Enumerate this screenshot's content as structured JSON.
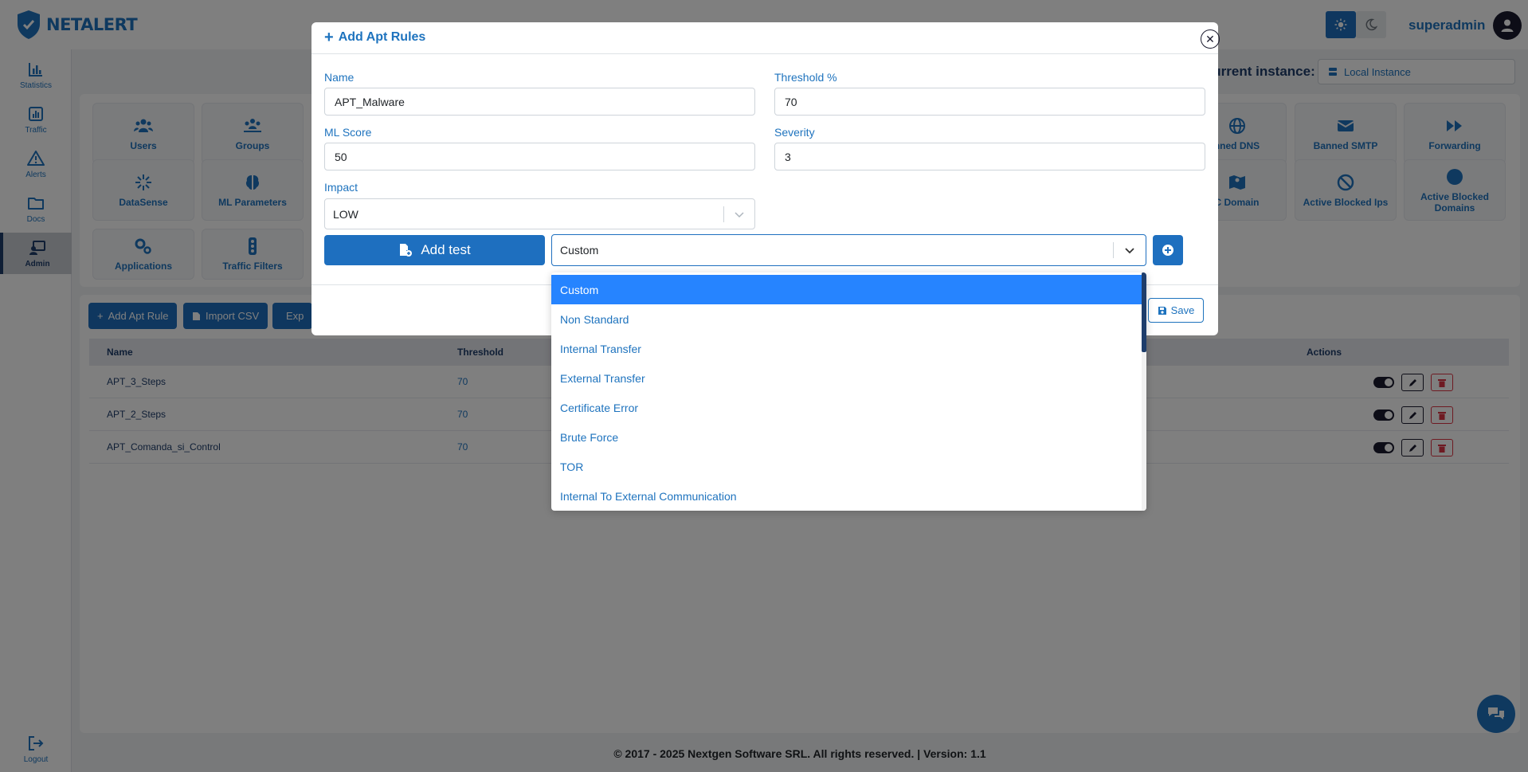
{
  "app": {
    "logo_text": "NETALERT",
    "user_name": "superadmin",
    "instance_label": "Current instance:",
    "instance_value": "Local Instance",
    "footer": "© 2017 - 2025 Nextgen Software SRL. All rights reserved. | Version: 1.1"
  },
  "sidebar": {
    "items": [
      {
        "label": "Statistics",
        "icon": "chart-icon"
      },
      {
        "label": "Traffic",
        "icon": "traffic-chart-icon"
      },
      {
        "label": "Alerts",
        "icon": "warning-icon"
      },
      {
        "label": "Docs",
        "icon": "folder-icon"
      },
      {
        "label": "Admin",
        "icon": "admin-icon",
        "active": true
      }
    ],
    "logout": "Logout"
  },
  "tiles": {
    "row1": [
      "Users",
      "Groups",
      "nned DNS",
      "Banned SMTP",
      "Forwarding"
    ],
    "row2": [
      "DataSense",
      "ML Parameters",
      "C Domain",
      "Active Blocked Ips",
      "Active Blocked Domains"
    ],
    "row3": [
      "Applications",
      "Traffic Filters"
    ]
  },
  "toolbar": {
    "add_rule": "Add Apt Rule",
    "import_csv": "Import CSV",
    "export": "Exp"
  },
  "table": {
    "headers": {
      "name": "Name",
      "threshold": "Threshold",
      "actions": "Actions"
    },
    "rows": [
      {
        "name": "APT_3_Steps",
        "threshold": "70"
      },
      {
        "name": "APT_2_Steps",
        "threshold": "70"
      },
      {
        "name": "APT_Comanda_si_Control",
        "threshold": "70"
      }
    ]
  },
  "modal": {
    "title": "Add Apt Rules",
    "name_label": "Name",
    "name_value": "APT_Malware",
    "threshold_label": "Threshold %",
    "threshold_value": "70",
    "ml_label": "ML Score",
    "ml_value": "50",
    "severity_label": "Severity",
    "severity_value": "3",
    "impact_label": "Impact",
    "impact_value": "LOW",
    "add_test": "Add test",
    "test_value": "Custom",
    "save": "Save"
  },
  "dropdown": {
    "options": [
      "Custom",
      "Non Standard",
      "Internal Transfer",
      "External Transfer",
      "Certificate Error",
      "Brute Force",
      "TOR",
      "Internal To External Communication"
    ],
    "selected_index": 0
  },
  "colors": {
    "primary": "#1e6fbf",
    "link": "#1e73be",
    "dark": "#1e3d6b",
    "option_highlight": "#2684ff",
    "danger": "#dc3545"
  }
}
